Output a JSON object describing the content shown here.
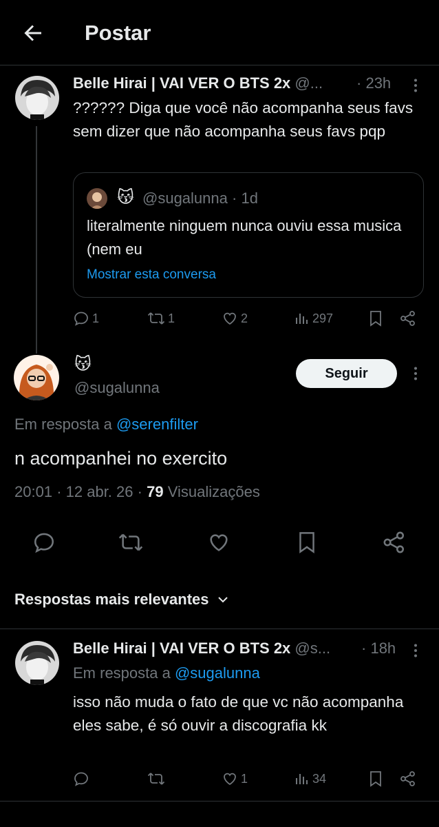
{
  "header": {
    "title": "Postar"
  },
  "parent_post": {
    "display_name": "Belle Hirai | VAI VER O BTS 2x",
    "handle": "@...",
    "separator": "·",
    "time": "23h",
    "text": "?????? Diga que você não acompanha seus favs sem dizer que não acompanha seus favs pqp",
    "quote": {
      "emoji": "😽",
      "handle": "@sugalunna",
      "separator": "·",
      "time": "1d",
      "text": "literalmente ninguem nunca ouviu essa musica (nem eu",
      "show_conversation": "Mostrar esta conversa"
    },
    "stats": {
      "replies": "1",
      "reposts": "1",
      "likes": "2",
      "views": "297"
    }
  },
  "main_post": {
    "emoji": "😽",
    "handle": "@sugalunna",
    "follow_label": "Seguir",
    "reply_prefix": "Em resposta a",
    "reply_to": "@serenfilter",
    "text": "n acompanhei no exercito",
    "time": "20:01",
    "dot1": "·",
    "date": "12 abr. 26",
    "dot2": "·",
    "views_count": "79",
    "views_label": "Visualizações"
  },
  "replies_filter": {
    "label": "Respostas mais relevantes"
  },
  "reply_post": {
    "display_name": "Belle Hirai | VAI VER O BTS 2x",
    "handle": "@s...",
    "separator": "·",
    "time": "18h",
    "reply_prefix": "Em resposta a",
    "reply_to": "@sugalunna",
    "text": "isso não muda o fato de que vc não acompanha eles sabe, é só ouvir a discografia kk",
    "stats": {
      "replies": "",
      "reposts": "",
      "likes": "1",
      "views": "34"
    }
  },
  "colors": {
    "background": "#000000",
    "text": "#e7e9ea",
    "muted": "#71767b",
    "link": "#1d9bf0",
    "divider": "#2f3336"
  }
}
